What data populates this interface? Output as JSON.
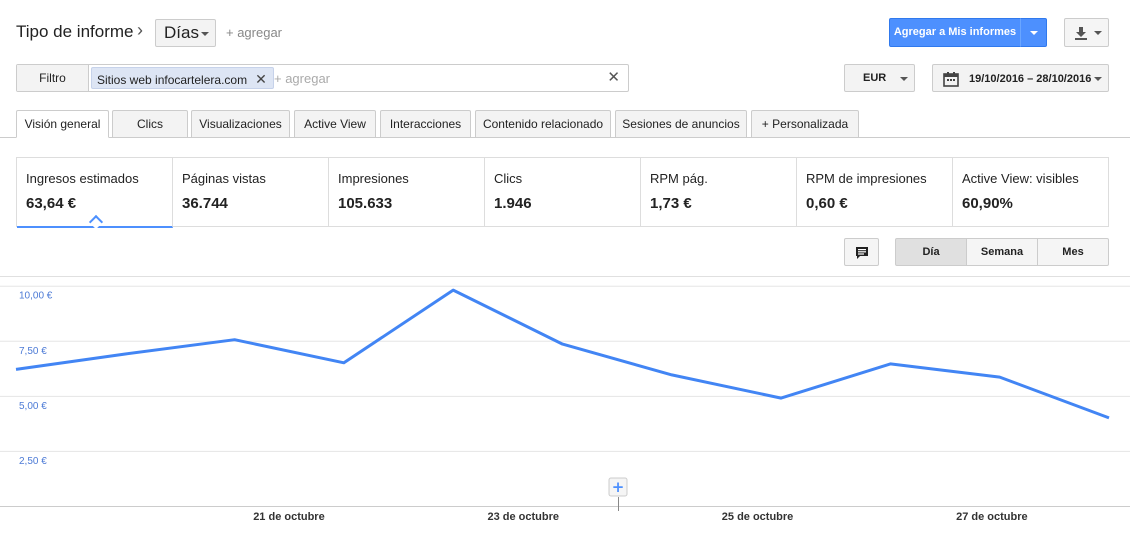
{
  "header": {
    "title": "Tipo de informe",
    "dimension": "Días",
    "add_label": "+ agregar",
    "add_to_reports": "Agregar a Mis informes"
  },
  "filter": {
    "label": "Filtro",
    "chip_prefix": "Sitios web ",
    "chip_value": "infocartelera.com",
    "add_placeholder": "+ agregar"
  },
  "currency": "EUR",
  "date_range": "19/10/2016 – 28/10/2016",
  "tabs": [
    {
      "label": "Visión general",
      "active": true
    },
    {
      "label": "Clics"
    },
    {
      "label": "Visualizaciones"
    },
    {
      "label": "Active View"
    },
    {
      "label": "Interacciones"
    },
    {
      "label": "Contenido relacionado"
    },
    {
      "label": "Sesiones de anuncios"
    },
    {
      "label": "+  Personalizada"
    }
  ],
  "metrics": [
    {
      "name": "Ingresos estimados",
      "value": "63,64 €",
      "active": true
    },
    {
      "name": "Páginas vistas",
      "value": "36.744"
    },
    {
      "name": "Impresiones",
      "value": "105.633"
    },
    {
      "name": "Clics",
      "value": "1.946"
    },
    {
      "name": "RPM pág.",
      "value": "1,73 €"
    },
    {
      "name": "RPM de impresiones",
      "value": "0,60 €"
    },
    {
      "name": "Active View: visibles",
      "value": "60,90%"
    }
  ],
  "granularity": [
    {
      "label": "Día",
      "active": true
    },
    {
      "label": "Semana"
    },
    {
      "label": "Mes"
    }
  ],
  "colors": {
    "accent": "#4d90fe",
    "line": "#4285f4"
  },
  "chart_data": {
    "type": "line",
    "x": [
      "19/10/2016",
      "20/10/2016",
      "21/10/2016",
      "22/10/2016",
      "23/10/2016",
      "24/10/2016",
      "25/10/2016",
      "26/10/2016",
      "27/10/2016",
      "28/10/2016"
    ],
    "x_tick_labels": [
      "21 de octubre",
      "23 de octubre",
      "25 de octubre",
      "27 de octubre"
    ],
    "x_tick_dates": [
      "21/10/2016",
      "23/10/2016",
      "25/10/2016",
      "27/10/2016"
    ],
    "y_tick_labels": [
      "10,00 €",
      "7,50 €",
      "5,00 €",
      "2,50 €"
    ],
    "y_ticks": [
      10,
      7.5,
      5,
      2.5
    ],
    "series": [
      {
        "values": [
          6.2,
          6.9,
          7.55,
          6.5,
          9.8,
          7.35,
          5.95,
          4.9,
          6.45,
          5.85,
          4.0
        ]
      }
    ],
    "ylim": [
      0,
      10.35
    ],
    "grid": true
  }
}
